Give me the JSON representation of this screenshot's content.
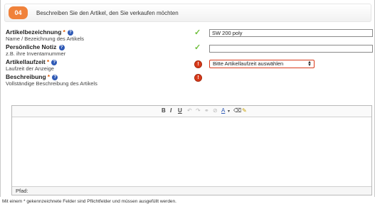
{
  "section": {
    "step_number": "04",
    "title": "Beschreiben Sie den Artikel, den Sie verkaufen möchten"
  },
  "fields": {
    "title": {
      "label": "Artikelbezeichnung",
      "required_mark": "*",
      "hint": "Name / Bezeichnung des Artikels",
      "value": "SW 200 poly",
      "status": "valid"
    },
    "note": {
      "label": "Persönliche Notiz",
      "hint": "z.B. ihre Inventarnummer",
      "value": "",
      "status": "valid"
    },
    "duration": {
      "label": "Artikellaufzeit",
      "required_mark": "*",
      "hint": "Laufzeit der Anzeige",
      "selected": "Bitte Artikellaufzeit auswählen",
      "status": "error"
    },
    "description": {
      "label": "Beschreibung",
      "required_mark": "*",
      "hint": "Vollständige Beschreibung des Artikels",
      "status": "error"
    }
  },
  "editor": {
    "toolbar": {
      "bold": "B",
      "italic": "I",
      "underline": "U",
      "undo": "↶",
      "redo": "↷",
      "link": "⚭",
      "unlink": "⊘",
      "text_color": "A",
      "color_dropdown": "▾",
      "cleanup": "⌫",
      "highlight": "✎"
    },
    "path_label": "Pfad:"
  },
  "footnote": "Mit einem * gekennzeichnete Felder sind Pflichtfelder und müssen ausgefüllt werden.",
  "colors": {
    "accent": "#f0823b",
    "required": "#e05a00",
    "valid": "#6fbf3c",
    "error": "#d93a1a",
    "help": "#2e59b5"
  },
  "icons": {
    "help": "question-circle-icon",
    "valid": "checkmark-icon",
    "error": "error-circle-icon"
  }
}
